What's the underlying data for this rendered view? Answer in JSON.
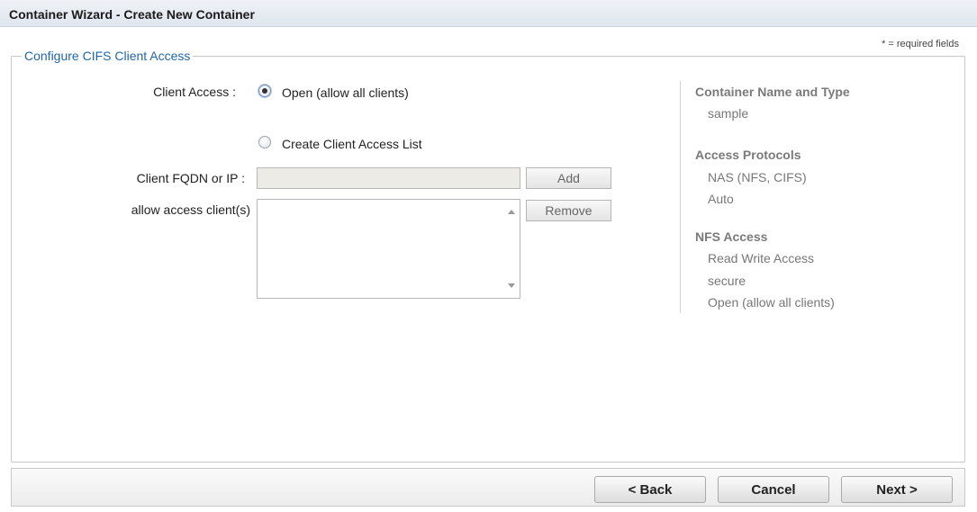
{
  "window": {
    "title": "Container Wizard - Create New Container"
  },
  "form": {
    "required_note": "* = required fields",
    "section_title": "Configure CIFS Client Access",
    "client_access_label": "Client Access :",
    "options": [
      {
        "label": "Open (allow all clients)",
        "selected": true
      },
      {
        "label": "Create Client Access List",
        "selected": false
      }
    ],
    "client_fqdn_label": "Client FQDN or IP :",
    "client_fqdn_value": "",
    "add_label": "Add",
    "allow_list_label": "allow access client(s)",
    "allow_list_items": [],
    "remove_label": "Remove"
  },
  "summary": {
    "sections": [
      {
        "heading": "Container Name and Type",
        "values": [
          "sample"
        ]
      },
      {
        "heading": "Access Protocols",
        "values": [
          "NAS (NFS, CIFS)",
          "Auto"
        ]
      },
      {
        "heading": "NFS Access",
        "values": [
          "Read Write Access",
          "secure",
          "Open (allow all clients)"
        ]
      }
    ]
  },
  "footer": {
    "back_label": "< Back",
    "cancel_label": "Cancel",
    "next_label": "Next >"
  }
}
